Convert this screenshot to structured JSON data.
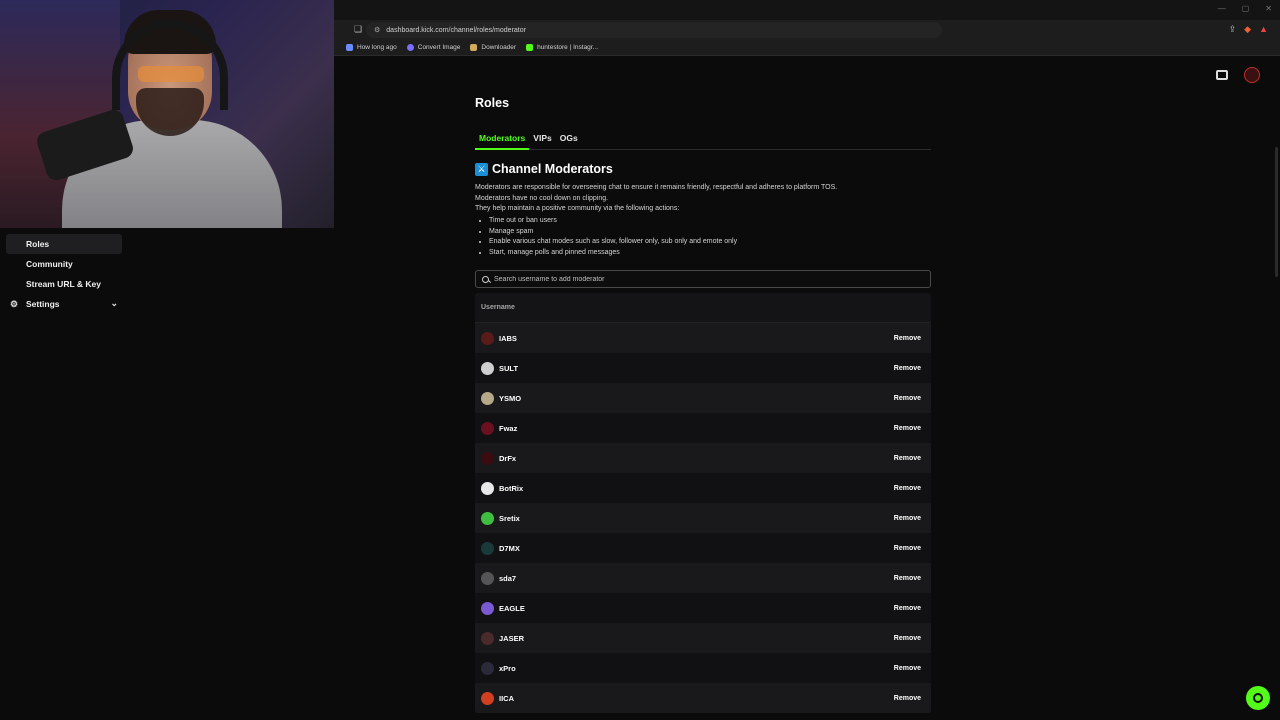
{
  "browser": {
    "url": "dashboard.kick.com/channel/roles/moderator",
    "bookmarks": [
      {
        "label": "How long ago",
        "color": "#6b8cff"
      },
      {
        "label": "Convert Image",
        "color": "#7c6cff"
      },
      {
        "label": "Downloader",
        "color": "#d1a95a"
      },
      {
        "label": "huntestore | Instagr...",
        "color": "#53fc18"
      }
    ]
  },
  "sidebar": {
    "items": [
      {
        "label": "Roles",
        "active": true
      },
      {
        "label": "Community",
        "active": false
      },
      {
        "label": "Stream URL & Key",
        "active": false
      },
      {
        "label": "Settings",
        "active": false
      }
    ]
  },
  "main": {
    "title": "Roles",
    "tabs": [
      "Moderators",
      "VIPs",
      "OGs"
    ],
    "section_title": "Channel Moderators",
    "description": [
      "Moderators are responsible for overseeing chat to ensure it remains friendly, respectful and adheres to platform TOS.",
      "Moderators have no cool down on clipping.",
      "They help maintain a positive community via the following actions:"
    ],
    "bullets": [
      "Time out or ban users",
      "Manage spam",
      "Enable various chat modes such as slow, follower only, sub only and emote only",
      "Start, manage polls and pinned messages"
    ],
    "search_placeholder": "Search username to add moderator",
    "table_header": "Username",
    "remove_label": "Remove",
    "moderators": [
      {
        "name": "IABS",
        "color": "#5a1a1a"
      },
      {
        "name": "SULT",
        "color": "#cfcfcf"
      },
      {
        "name": "YSMO",
        "color": "#b5a98a"
      },
      {
        "name": "Fwaz",
        "color": "#6a1020"
      },
      {
        "name": "DrFx",
        "color": "#3a0c10"
      },
      {
        "name": "BotRix",
        "color": "#e8e8e8"
      },
      {
        "name": "Sretix",
        "color": "#3fbf3f"
      },
      {
        "name": "D7MX",
        "color": "#1a3a3a"
      },
      {
        "name": "sda7",
        "color": "#555555"
      },
      {
        "name": "EAGLE",
        "color": "#7a5ad0"
      },
      {
        "name": "JASER",
        "color": "#4a2a2a"
      },
      {
        "name": "xPro",
        "color": "#2a2a3a"
      },
      {
        "name": "IICA",
        "color": "#d04020"
      }
    ]
  }
}
